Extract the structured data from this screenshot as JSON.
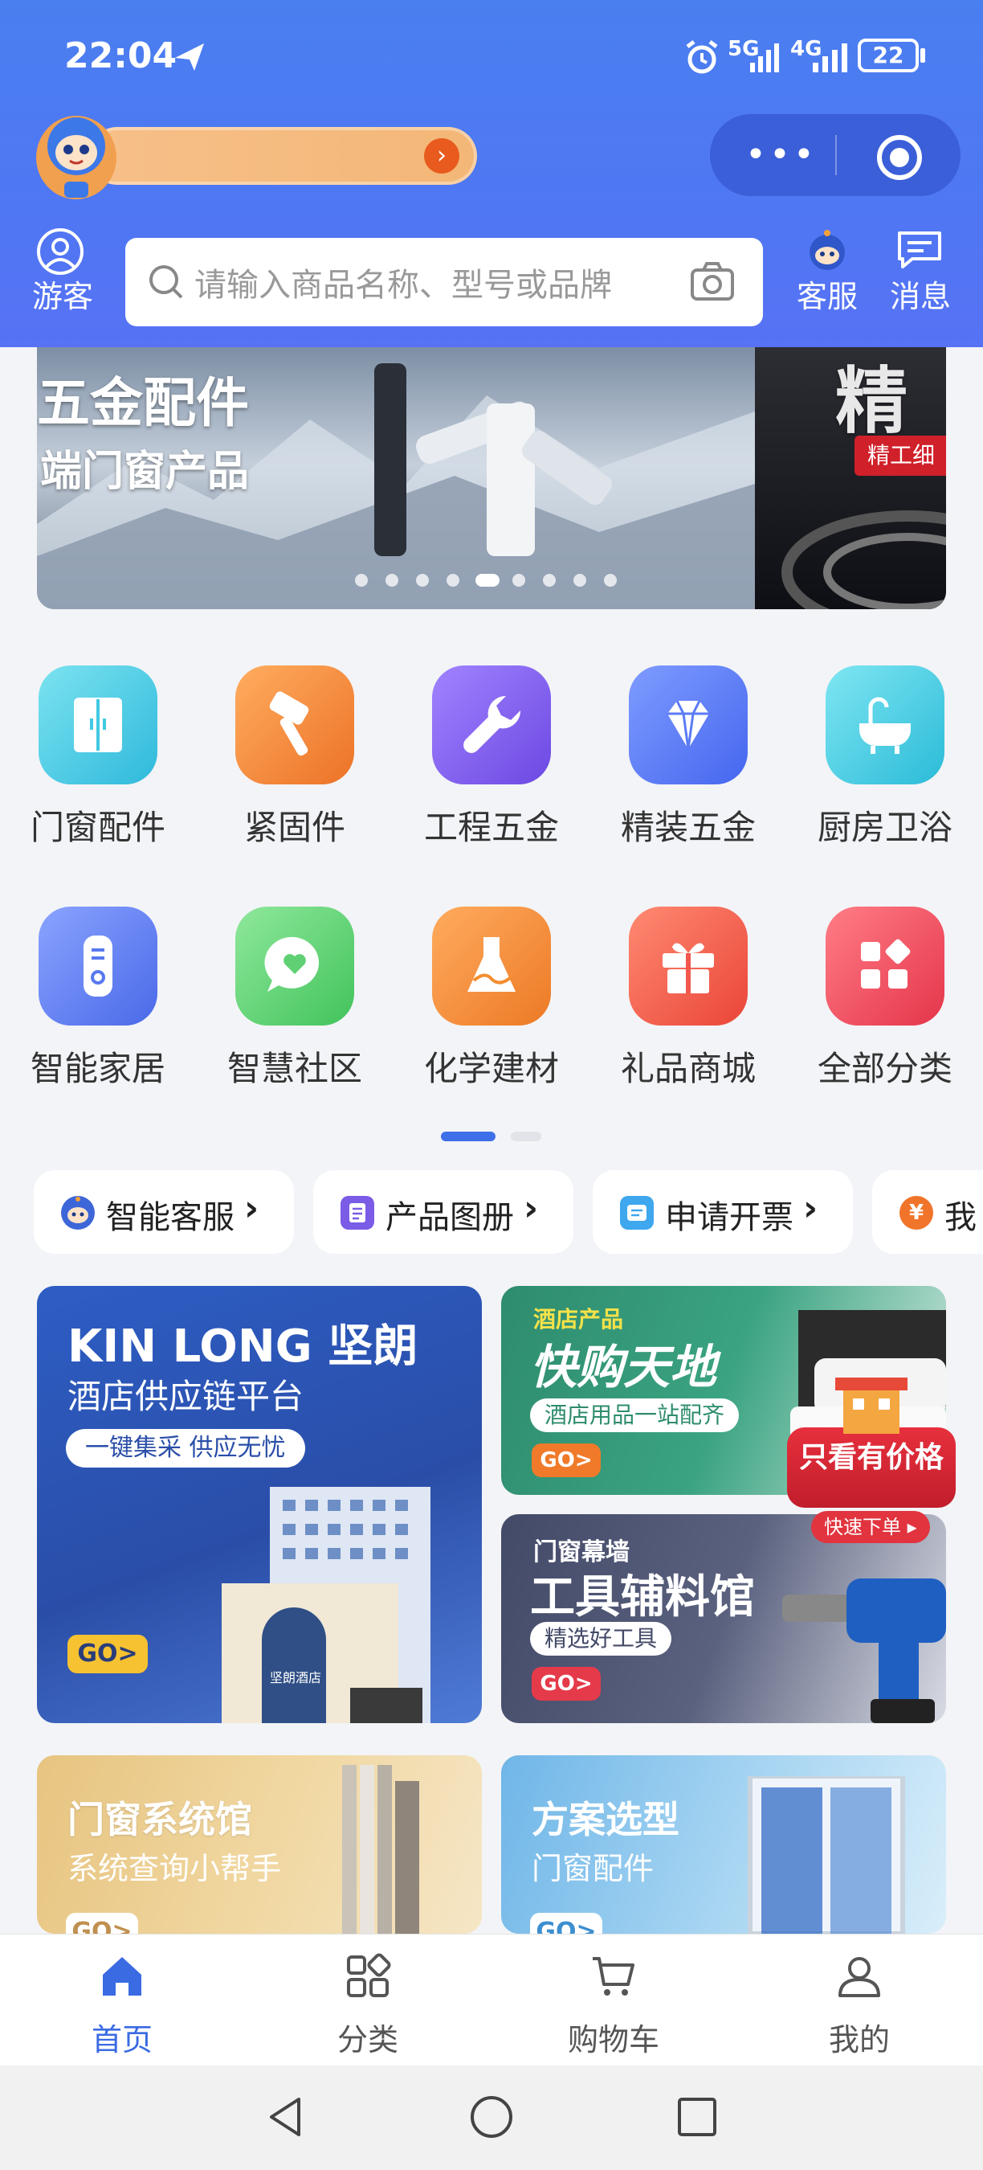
{
  "status_bar": {
    "time": "22:04",
    "battery": "22",
    "net1": "5G",
    "net2": "4G"
  },
  "header": {
    "guest_label": "游客",
    "search_placeholder": "请输入商品名称、型号或品牌",
    "service_label": "客服",
    "message_label": "消息"
  },
  "banner": {
    "line1": "五金配件",
    "line2": "端门窗产品",
    "side_text": "精工细",
    "side_title": "精",
    "dot_count": 9,
    "active_dot": 5
  },
  "categories": [
    {
      "label": "门窗配件",
      "icon": "door-icon",
      "color": "#41c9e3"
    },
    {
      "label": "紧固件",
      "icon": "hammer-icon",
      "color": "#f38b33"
    },
    {
      "label": "工程五金",
      "icon": "wrench-icon",
      "color": "#8160ef"
    },
    {
      "label": "精装五金",
      "icon": "diamond-icon",
      "color": "#5b7bf5"
    },
    {
      "label": "厨房卫浴",
      "icon": "bathtub-icon",
      "color": "#3fc7e0"
    },
    {
      "label": "智能家居",
      "icon": "remote-icon",
      "color": "#5878f0"
    },
    {
      "label": "智慧社区",
      "icon": "chat-heart-icon",
      "color": "#5fd174"
    },
    {
      "label": "化学建材",
      "icon": "flask-icon",
      "color": "#f38d2f"
    },
    {
      "label": "礼品商城",
      "icon": "gift-icon",
      "color": "#f2574d"
    },
    {
      "label": "全部分类",
      "icon": "grid-icon",
      "color": "#ef4c5c"
    }
  ],
  "shortcuts": [
    {
      "label": "智能客服",
      "icon": "robot-icon"
    },
    {
      "label": "产品图册",
      "icon": "album-icon"
    },
    {
      "label": "申请开票",
      "icon": "invoice-icon"
    },
    {
      "label": "我",
      "icon": "yen-icon"
    }
  ],
  "promos": {
    "hotel": {
      "brand": "KIN LONG 坚朗",
      "title": "酒店供应链平台",
      "tag": "一键集采 供应无忧",
      "go": "GO>",
      "sign": "坚朗酒店"
    },
    "fast": {
      "kicker": "酒店产品",
      "title": "快购天地",
      "tag": "酒店用品一站配齐",
      "go": "GO>"
    },
    "tools": {
      "kicker": "门窗幕墙",
      "title": "工具辅料馆",
      "tag": "精选好工具",
      "go": "GO>",
      "badge": "只看有价格",
      "badge2": "快速下单"
    },
    "system": {
      "title": "门窗系统馆",
      "sub": "系统查询小帮手",
      "go": "GO>"
    },
    "scheme": {
      "title": "方案选型",
      "sub": "门窗配件",
      "go": "GO>"
    }
  },
  "tabbar": [
    {
      "label": "首页",
      "active": true
    },
    {
      "label": "分类",
      "active": false
    },
    {
      "label": "购物车",
      "active": false
    },
    {
      "label": "我的",
      "active": false
    }
  ],
  "colors": {
    "primary": "#4a7ff0",
    "tab_active": "#3a6be3",
    "tab_inactive": "#555555"
  }
}
